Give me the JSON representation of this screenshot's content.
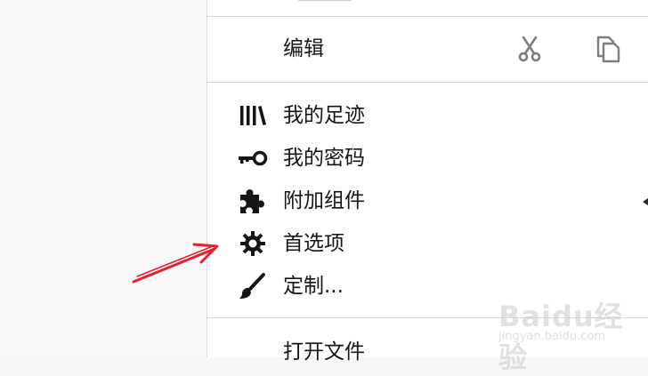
{
  "menu": {
    "edit": {
      "label": "编辑"
    },
    "items": [
      {
        "label": "我的足迹",
        "icon": "library-icon"
      },
      {
        "label": "我的密码",
        "icon": "key-icon"
      },
      {
        "label": "附加组件",
        "icon": "puzzle-icon"
      },
      {
        "label": "首选项",
        "icon": "gear-icon"
      },
      {
        "label": "定制...",
        "icon": "paintbrush-icon"
      }
    ],
    "open_file": {
      "label": "打开文件"
    }
  },
  "annotation": {
    "arrow_color": "#e0232d"
  },
  "watermark": {
    "main": "Baidu经验",
    "sub": "jingyan.baidu.com"
  }
}
